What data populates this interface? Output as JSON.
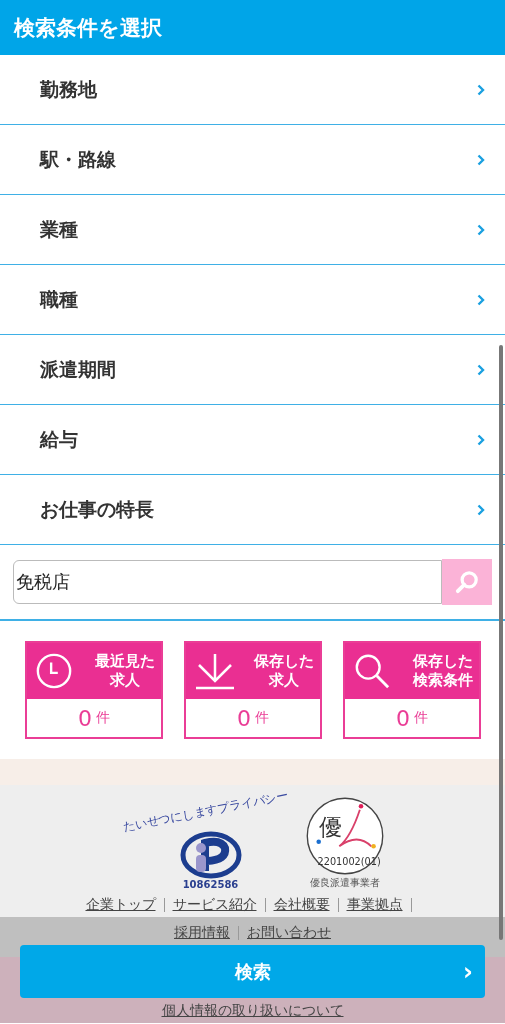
{
  "header": {
    "title": "検索条件を選択"
  },
  "menu_items": [
    {
      "label": "勤務地"
    },
    {
      "label": "駅・路線"
    },
    {
      "label": "業種"
    },
    {
      "label": "職種"
    },
    {
      "label": "派遣期間"
    },
    {
      "label": "給与"
    },
    {
      "label": "お仕事の特長"
    }
  ],
  "keyword_search": {
    "value": "免税店"
  },
  "shortcuts": [
    {
      "kind": "clock",
      "label_lines": [
        "最近見た",
        "求人"
      ],
      "count": "0",
      "unit": "件"
    },
    {
      "kind": "download",
      "label_lines": [
        "保存した",
        "求人"
      ],
      "count": "0",
      "unit": "件"
    },
    {
      "kind": "search",
      "label_lines": [
        "保存した",
        "検索条件"
      ],
      "count": "0",
      "unit": "件"
    }
  ],
  "footer": {
    "privacy_mark": {
      "arc_text": "たいせつにしますプライバシー",
      "number": "10862586"
    },
    "dispatch_mark": {
      "glyph": "優",
      "code": "2201002(01)",
      "caption": "優良派遣事業者"
    },
    "links": [
      {
        "label": "企業トップ"
      },
      {
        "label": "サービス紹介"
      },
      {
        "label": "会社概要"
      },
      {
        "label": "事業拠点"
      },
      {
        "label": "採用情報"
      },
      {
        "label": "お問い合わせ"
      }
    ],
    "policy_link": "個人情報の取り扱いについて"
  },
  "search_button": {
    "label": "検索",
    "arrow": "›"
  }
}
